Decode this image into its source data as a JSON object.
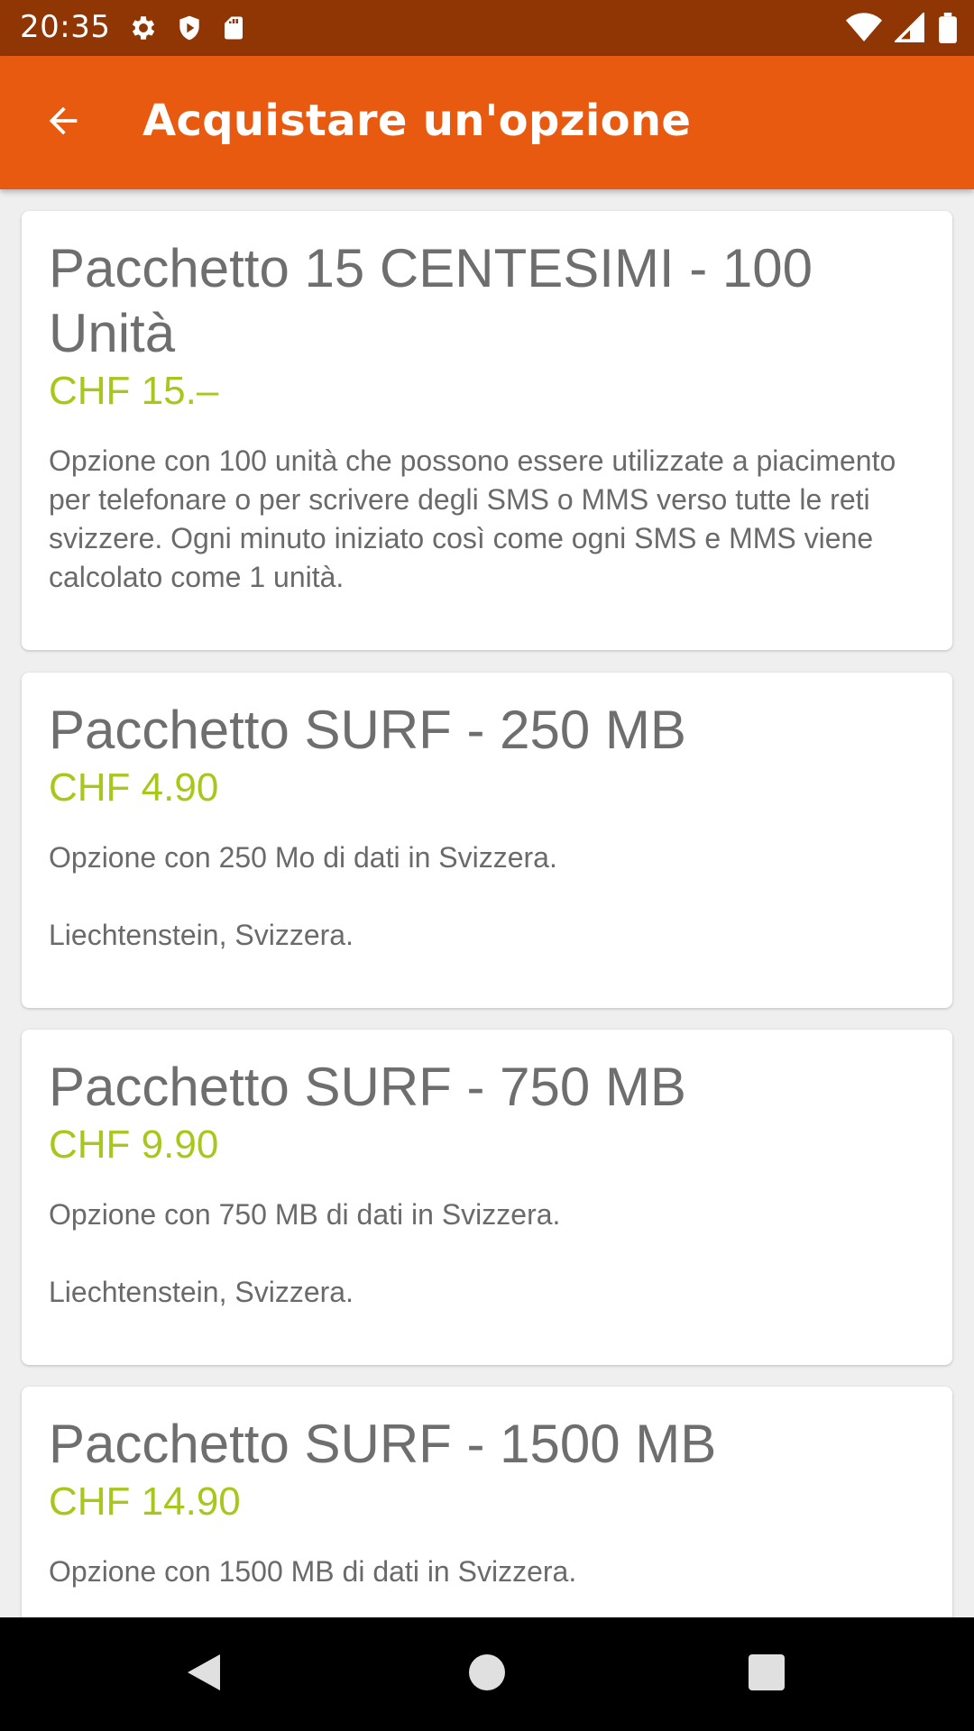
{
  "status_bar": {
    "time": "20:35",
    "left_icons": [
      "gear-icon",
      "shield-icon",
      "sd-card-icon"
    ],
    "right_icons": [
      "wifi-icon",
      "signal-icon",
      "battery-icon"
    ]
  },
  "app_bar": {
    "title": "Acquistare un'opzione",
    "back_icon": "arrow-back-icon",
    "background": "#e85a0f"
  },
  "colors": {
    "status_bar": "#8f3604",
    "price": "#a7c71b",
    "title": "#6e6e6e",
    "text": "#6a6a6a"
  },
  "options": [
    {
      "title": "Pacchetto 15 CENTESIMI - 100 Unità",
      "price": "CHF 15.–",
      "description": "Opzione con 100 unità che possono essere utilizzate a piacimento per telefonare o per scrivere degli SMS o MMS verso tutte le reti svizzere. Ogni minuto iniziato così come ogni SMS e MMS viene calcolato come 1 unità.",
      "note": ""
    },
    {
      "title": "Pacchetto SURF - 250 MB",
      "price": "CHF 4.90",
      "description": "Opzione con 250 Mo di dati in Svizzera.",
      "note": "Liechtenstein, Svizzera."
    },
    {
      "title": "Pacchetto SURF - 750 MB",
      "price": "CHF 9.90",
      "description": "Opzione con 750 MB di dati in Svizzera.",
      "note": "Liechtenstein, Svizzera."
    },
    {
      "title": "Pacchetto SURF - 1500 MB",
      "price": "CHF 14.90",
      "description": "Opzione con 1500 MB di dati in Svizzera.",
      "note": ""
    }
  ],
  "nav_bar": {
    "buttons": [
      "back-triangle-icon",
      "home-circle-icon",
      "recents-square-icon"
    ]
  }
}
